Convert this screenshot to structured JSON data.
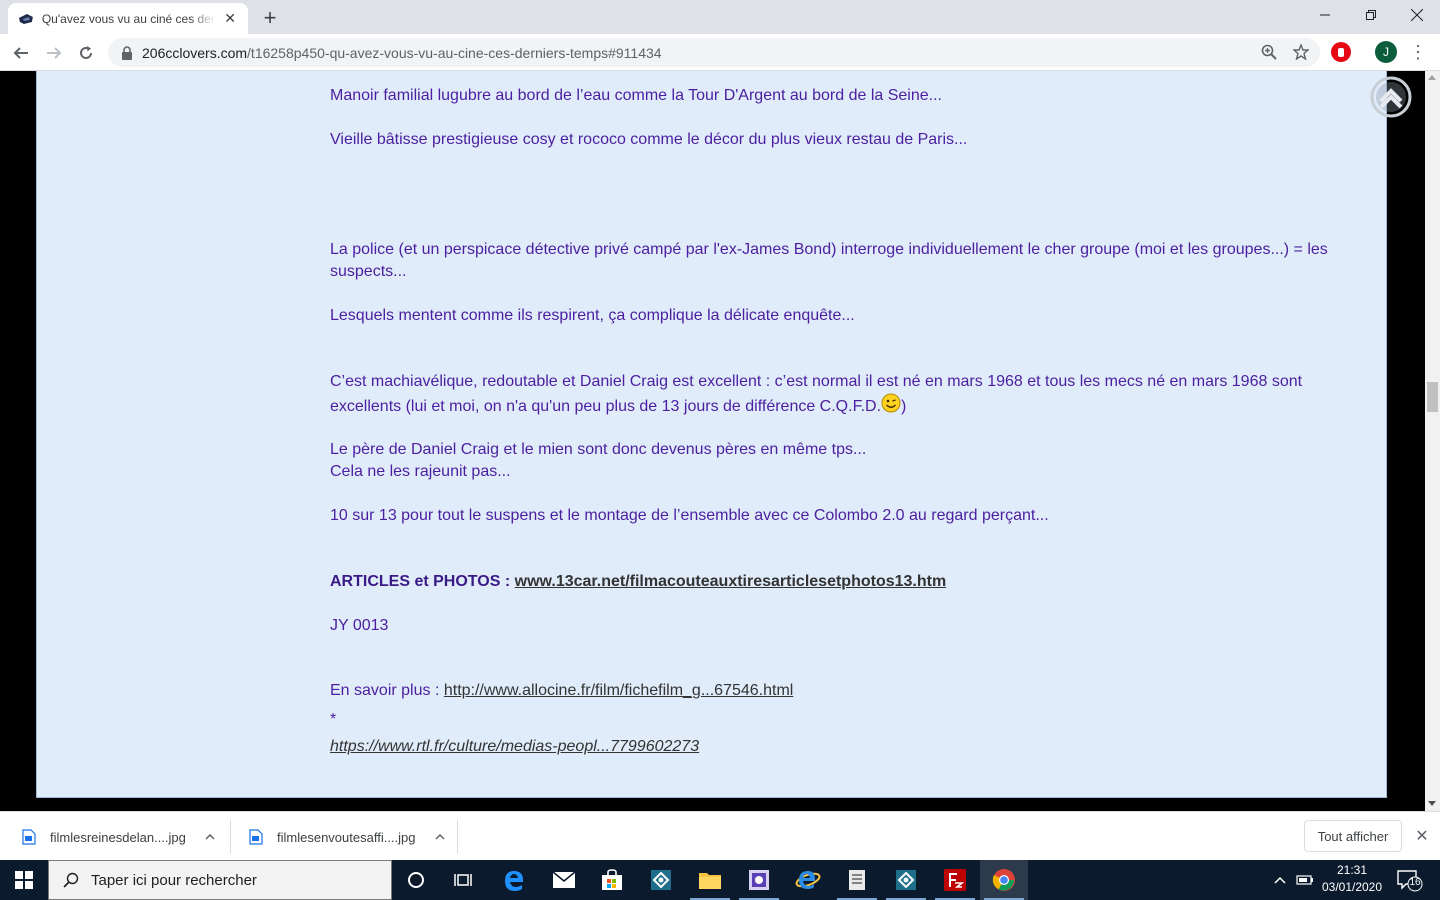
{
  "browser": {
    "tab_title": "Qu'avez vous vu au ciné ces derniers temps",
    "url_domain": "206cclovers.com",
    "url_path": "/t16258p450-qu-avez-vous-vu-au-cine-ces-derniers-temps#911434",
    "profile_initial": "J"
  },
  "post": {
    "p1": "Manoir familial lugubre au bord de l’eau comme la Tour D'Argent au bord de la Seine...",
    "p2": "Vieille bâtisse prestigieuse cosy et rococo comme le décor du plus vieux restau de Paris...",
    "p3_line1": "La police (et un perspicace détective privé campé par l'ex-James Bond) interroge individuellement le cher groupe (moi et les groupes...) = les",
    "p3_line2": "suspects...",
    "p4": "Lesquels mentent comme ils respirent, ça complique la délicate enquête...",
    "p5_line1": "C’est machiavélique, redoutable et Daniel Craig est excellent : c’est normal il est né en mars 1968 et tous les mecs né en mars 1968 sont",
    "p5_line2": "excellents (lui et moi, on n'a qu'un peu plus de 13 jours de différence C.Q.F.D.",
    "p5_close": ")",
    "p6_line1": "Le père de Daniel Craig et le mien sont donc devenus pères en même tps...",
    "p6_line2": "Cela ne les rajeunit pas...",
    "p7": "10 sur 13 pour tout le suspens et le montage de l’ensemble avec ce Colombo 2.0 au regard perçant...",
    "articles_label": "ARTICLES et PHOTOS :",
    "articles_link": "www.13car.net/filmacouteauxtiresarticlesetphotos13.htm",
    "signature": "JY 0013",
    "more_label": "En savoir plus :",
    "more_link": "http://www.allocine.fr/film/fichefilm_g...67546.html",
    "asterisk": "*",
    "rtl_link": "https://www.rtl.fr/culture/medias-peopl...7799602273"
  },
  "downloads": {
    "items": [
      {
        "name": "filmlesreinesdelan....jpg"
      },
      {
        "name": "filmlesenvoutesaffi....jpg"
      }
    ],
    "show_all": "Tout afficher"
  },
  "taskbar": {
    "search_placeholder": "Taper ici pour rechercher",
    "time": "21:31",
    "date": "03/01/2020",
    "notifications": "16"
  },
  "colors": {
    "post_bg": "#e0ecfa",
    "text_purple": "#4b1fa0",
    "taskbar": "#0b1a2c"
  }
}
